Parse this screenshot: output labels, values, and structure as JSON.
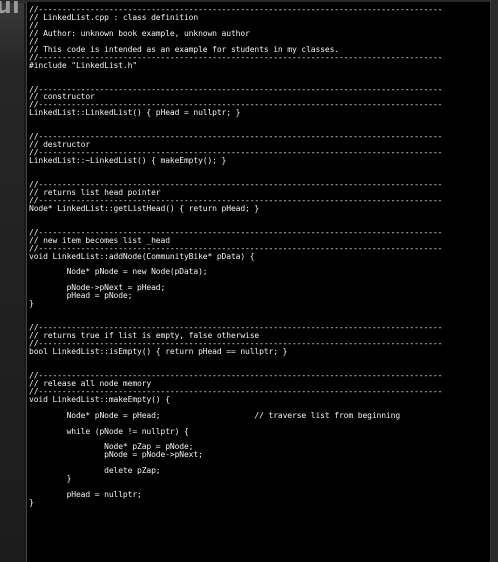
{
  "background": {
    "partial_title": "ui"
  },
  "colors": {
    "editor_bg": "#000000",
    "code_text": "#f2f2f2",
    "backdrop": "#1a1a1a"
  },
  "editor": {
    "lines": [
      "//--------------------------------------------------------------------------------------",
      "// LinkedList.cpp : class definition",
      "//",
      "// Author: unknown book example, unknown author",
      "//",
      "// This code is intended as an example for students in my classes.",
      "//--------------------------------------------------------------------------------------",
      "#include \"LinkedList.h\"",
      "",
      "",
      "//--------------------------------------------------------------------------------------",
      "// constructor",
      "//--------------------------------------------------------------------------------------",
      "LinkedList::LinkedList() { pHead = nullptr; }",
      "",
      "",
      "//--------------------------------------------------------------------------------------",
      "// destructor",
      "//--------------------------------------------------------------------------------------",
      "LinkedList::~LinkedList() { makeEmpty(); }",
      "",
      "",
      "//--------------------------------------------------------------------------------------",
      "// returns list head pointer",
      "//--------------------------------------------------------------------------------------",
      "Node* LinkedList::getListHead() { return pHead; }",
      "",
      "",
      "//--------------------------------------------------------------------------------------",
      "// new item becomes list _head",
      "//--------------------------------------------------------------------------------------",
      "void LinkedList::addNode(CommunityBike* pData) {",
      "",
      "        Node* pNode = new Node(pData);",
      "",
      "        pNode->pNext = pHead;",
      "        pHead = pNode;",
      "}",
      "",
      "",
      "//--------------------------------------------------------------------------------------",
      "// returns true if list is empty, false otherwise",
      "//--------------------------------------------------------------------------------------",
      "bool LinkedList::isEmpty() { return pHead == nullptr; }",
      "",
      "",
      "//--------------------------------------------------------------------------------------",
      "// release all node memory",
      "//--------------------------------------------------------------------------------------",
      "void LinkedList::makeEmpty() {",
      "",
      "        Node* pNode = pHead;                    // traverse list from beginning",
      "",
      "        while (pNode != nullptr) {",
      "",
      "                Node* pZap = pNode;",
      "                pNode = pNode->pNext;",
      "",
      "                delete pZap;",
      "        }",
      "",
      "        pHead = nullptr;",
      "}"
    ]
  }
}
